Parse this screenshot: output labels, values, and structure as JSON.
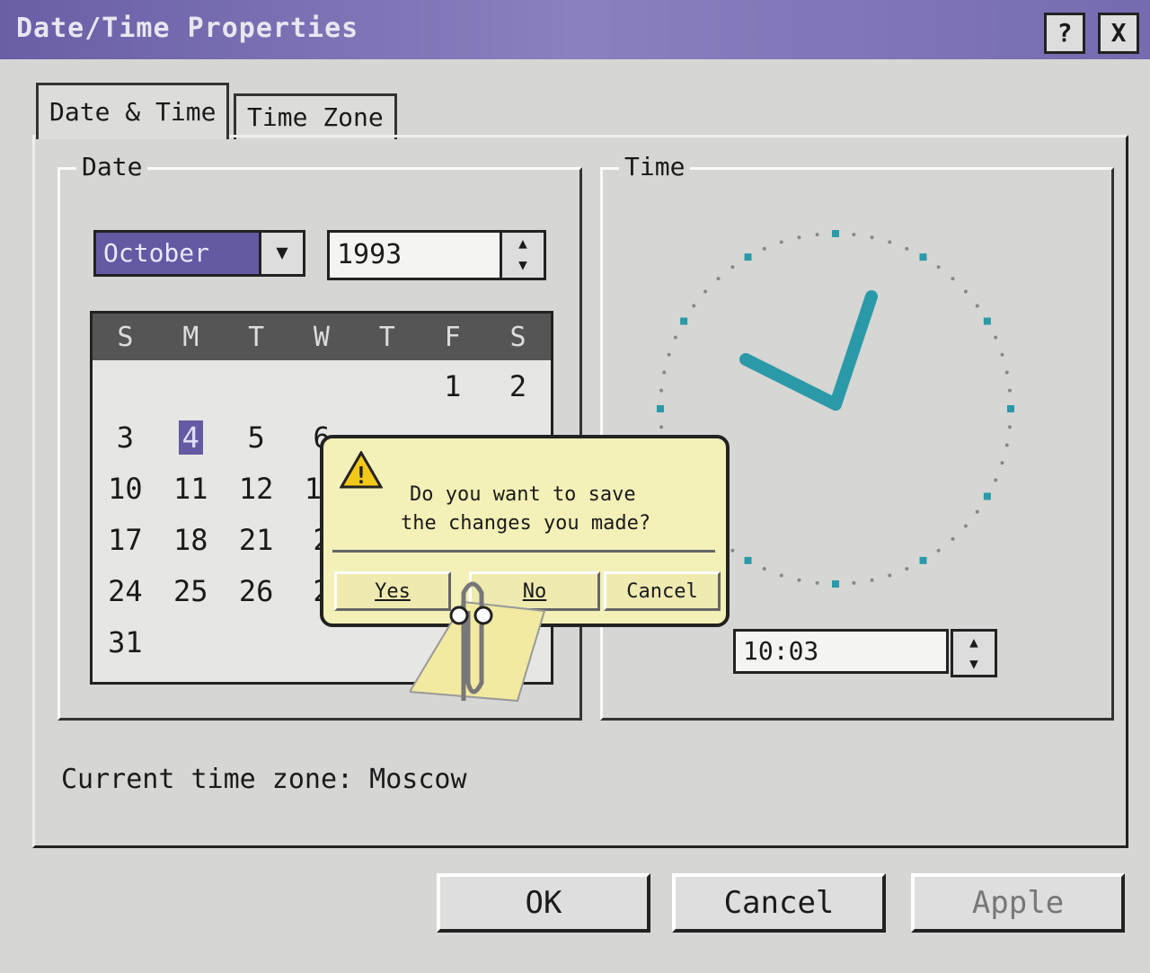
{
  "window": {
    "title": "Date/Time Properties",
    "help": "?",
    "close": "X"
  },
  "tabs": [
    {
      "label": "Date & Time",
      "active": true
    },
    {
      "label": "Time Zone",
      "active": false
    }
  ],
  "date": {
    "label": "Date",
    "month": "October",
    "year": "1993",
    "weekdays": [
      "S",
      "M",
      "T",
      "W",
      "T",
      "F",
      "S"
    ],
    "days": [
      "",
      "",
      "",
      "",
      "",
      "1",
      "2",
      "3",
      "4",
      "5",
      "6",
      "",
      "",
      "",
      "10",
      "11",
      "12",
      "13",
      "",
      "",
      "",
      "17",
      "18",
      "21",
      "2",
      "",
      "",
      "",
      "24",
      "25",
      "26",
      "2",
      "",
      "",
      "",
      "31",
      "",
      "",
      "",
      "",
      "",
      ""
    ],
    "selected_day": "4"
  },
  "time": {
    "label": "Time",
    "value": "10:03"
  },
  "timezone_text": "Current time zone: Moscow",
  "buttons": {
    "ok": "OK",
    "cancel": "Cancel",
    "apply": "Apple"
  },
  "popup": {
    "message_line1": "Do you want to save",
    "message_line2": "the changes you made?",
    "yes": "Yes",
    "no": "No",
    "cancel": "Cancel",
    "icon": "warning-icon"
  },
  "colors": {
    "title_bar": "#6a5fa6",
    "accent": "#6459a3",
    "clock_accent": "#2a9aa8",
    "popup_bg": "#f3f0b8"
  }
}
